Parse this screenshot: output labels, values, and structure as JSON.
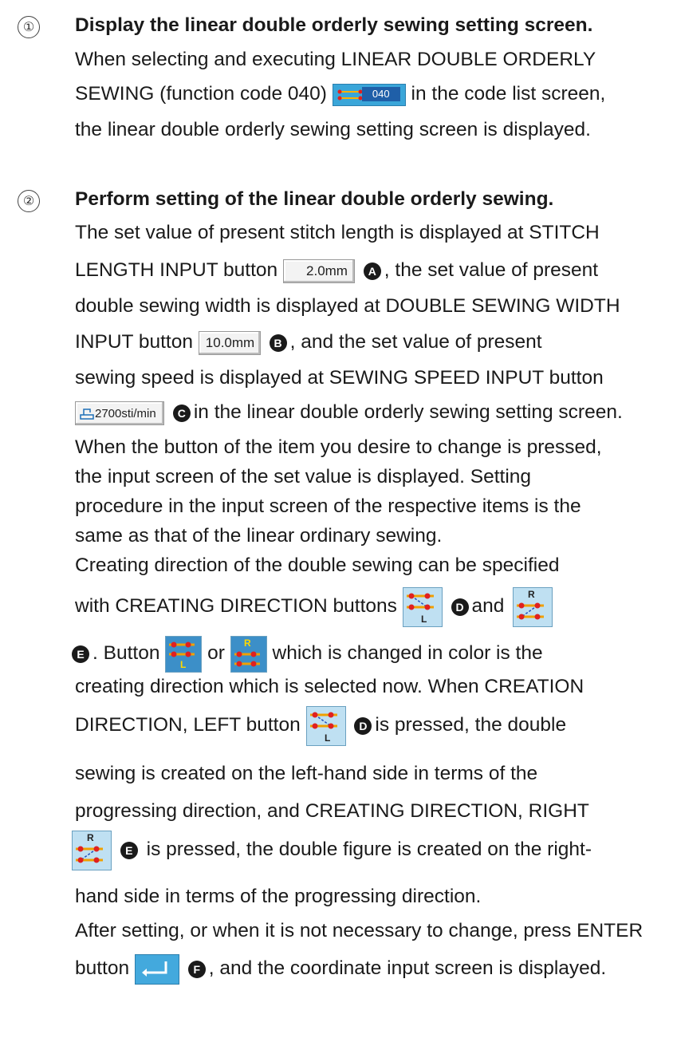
{
  "step1": {
    "number": "①",
    "heading": "Display the linear double orderly sewing setting screen.",
    "lines": [
      "When selecting and executing LINEAR DOUBLE ORDERLY",
      "SEWING (function code 040)",
      "in the code list screen,",
      "the linear double orderly sewing setting screen is displayed."
    ],
    "code_button_text": "040"
  },
  "step2": {
    "number": "②",
    "heading": "Perform setting of the linear double orderly sewing.",
    "lines": {
      "l1": "The set value of present stitch length is displayed at STITCH",
      "l2a": "LENGTH INPUT button",
      "l2b": ", the set value of present",
      "l3": "double sewing width is displayed at DOUBLE SEWING WIDTH",
      "l4a": "INPUT button",
      "l4b": ", and the set value of present",
      "l5": "sewing speed is displayed at SEWING SPEED INPUT button",
      "l6b": "in the linear double orderly sewing setting screen.",
      "l7": "When the button of the item you desire to change is pressed,",
      "l8": "the input screen of the set value is displayed. Setting",
      "l9": "procedure in the input screen of the respective items is the",
      "l10": "same as that of the linear ordinary sewing.",
      "l11": "Creating direction of the double sewing can be specified",
      "l12a": "with CREATING DIRECTION buttons",
      "l12b": "and",
      "l13a": ". Button",
      "l13b": "or",
      "l13c": "which is changed in color is the",
      "l14": "creating direction which is selected now. When CREATION",
      "l15a": "DIRECTION, LEFT button",
      "l15b": "is pressed, the double",
      "l16": "sewing is created on the left-hand side in terms of the",
      "l17": "progressing direction, and CREATING DIRECTION, RIGHT",
      "l18b": "is pressed, the double figure is created on the right-",
      "l19": "hand side in terms of the progressing direction.",
      "l20": "After setting, or when it is not necessary to change, press ENTER",
      "l21a": "button",
      "l21b": ", and the coordinate input screen is displayed."
    },
    "buttons": {
      "stitch_length": "2.0mm",
      "double_width": "10.0mm",
      "sewing_speed": "2700sti/min",
      "left_label": "L",
      "right_label": "R"
    },
    "badges": {
      "a": "A",
      "b": "B",
      "c": "C",
      "d": "D",
      "e": "E",
      "f": "F"
    }
  }
}
